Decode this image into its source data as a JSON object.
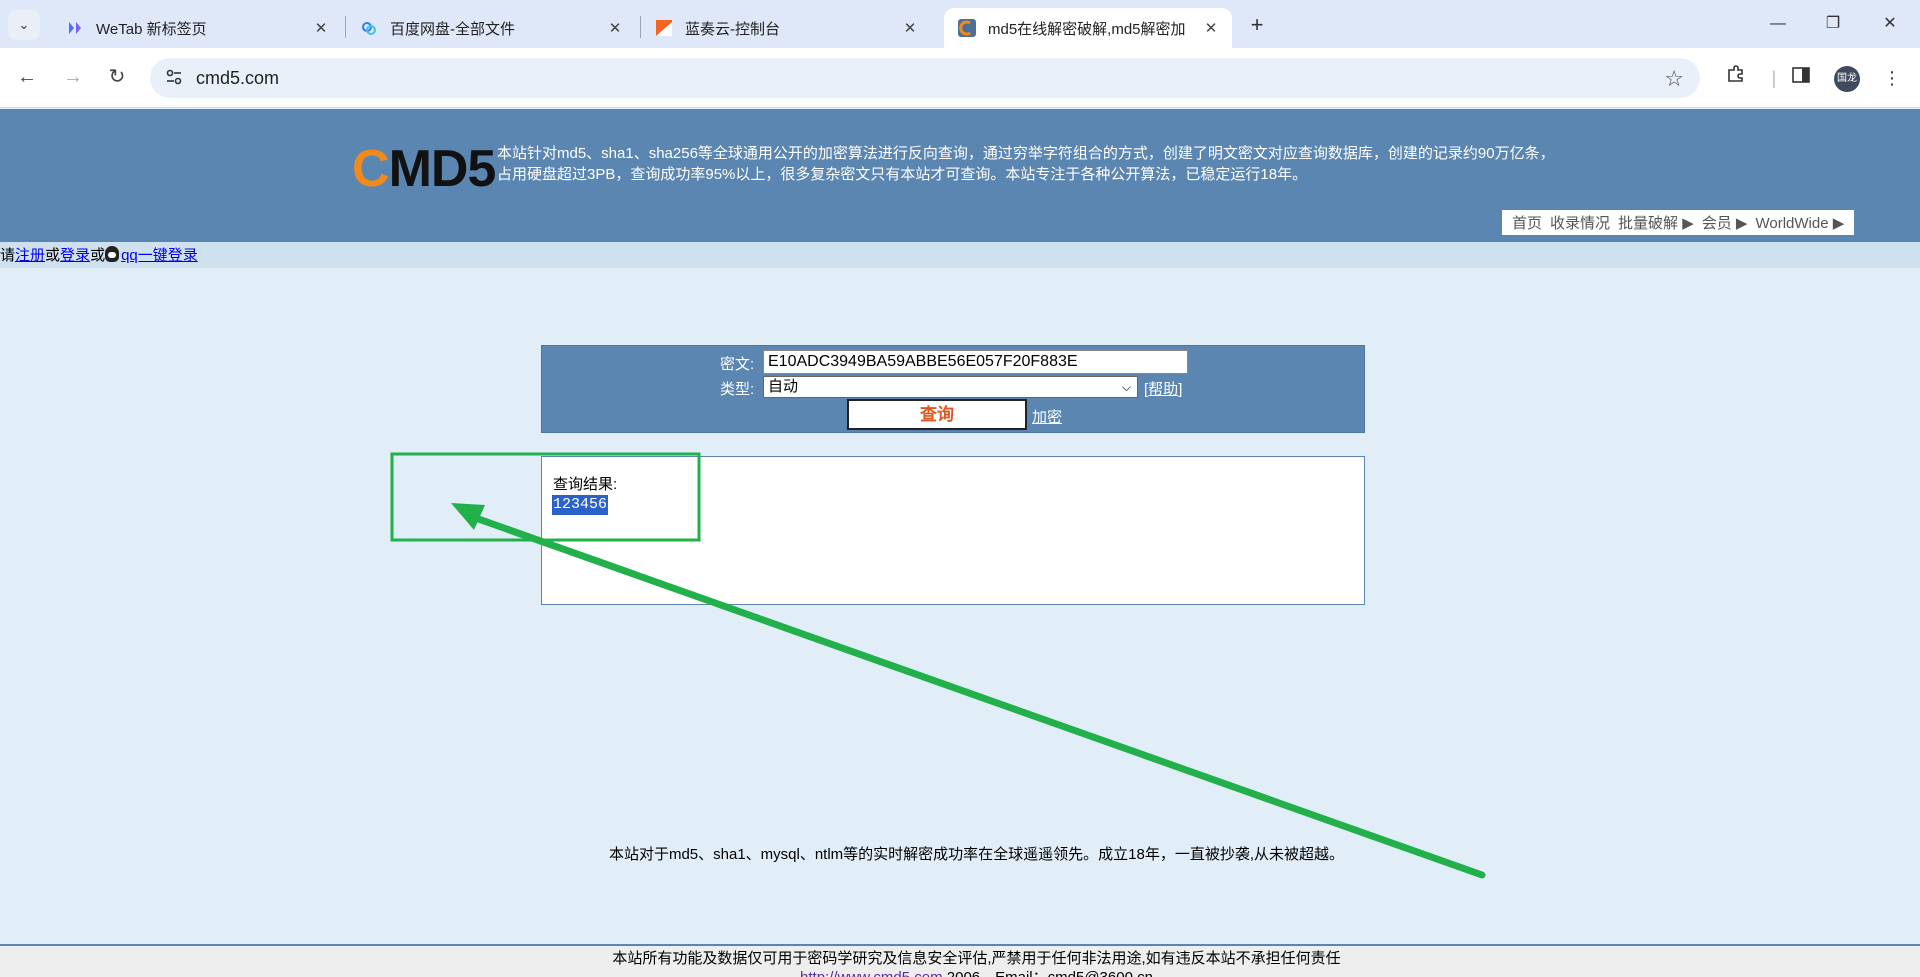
{
  "browser": {
    "tabs": [
      {
        "title": "WeTab 新标签页",
        "favicon": "wetab-icon"
      },
      {
        "title": "百度网盘-全部文件",
        "favicon": "baidu-netdisk-icon"
      },
      {
        "title": "蓝奏云-控制台",
        "favicon": "lanzou-icon"
      },
      {
        "title": "md5在线解密破解,md5解密加",
        "favicon": "cmd5-icon",
        "active": true
      }
    ],
    "url": "cmd5.com",
    "profile_label": "国龙"
  },
  "site": {
    "logo_c": "C",
    "logo_rest": "MD5",
    "intro_line1": "本站针对md5、sha1、sha256等全球通用公开的加密算法进行反向查询，通过穷举字符组合的方式，创建了明文密文对应查询数据库，创建的记录约90万亿条，",
    "intro_line2": "占用硬盘超过3PB，查询成功率95%以上，很多复杂密文只有本站才可查询。本站专注于各种公开算法，已稳定运行18年。",
    "nav": [
      "首页",
      "收录情况",
      "批量破解 ▶",
      "会员 ▶",
      "WorldWide ▶"
    ]
  },
  "login_bar": {
    "prefix": "请",
    "register": "注册",
    "or1": "或",
    "login": "登录",
    "or2": "或",
    "qq_login": "qq一键登录"
  },
  "query_form": {
    "cipher_label": "密文:",
    "cipher_value": "E10ADC3949BA59ABBE56E057F20F883E",
    "type_label": "类型:",
    "type_value": "自动",
    "help_open": "[",
    "help_text": "帮助",
    "help_close": "]",
    "query_button": "查询",
    "encrypt_link": "加密"
  },
  "result": {
    "label": "查询结果:",
    "value": "123456"
  },
  "tagline": "本站对于md5、sha1、mysql、ntlm等的实时解密成功率在全球遥遥领先。成立18年，一直被抄袭,从未被超越。",
  "footer": {
    "line1": "本站所有功能及数据仅可用于密码学研究及信息安全评估,严禁用于任何非法用途,如有违反本站不承担任何责任",
    "link": "http://www.cmd5.com",
    "line2_rest": " 2006，Email：cmd5@3600.cn"
  },
  "colors": {
    "header_bg": "#5b86b1",
    "page_bg": "#e1eef8",
    "annotation_green": "#22b04b",
    "query_button_text": "#e0581f",
    "logo_orange": "#f08a1c"
  }
}
